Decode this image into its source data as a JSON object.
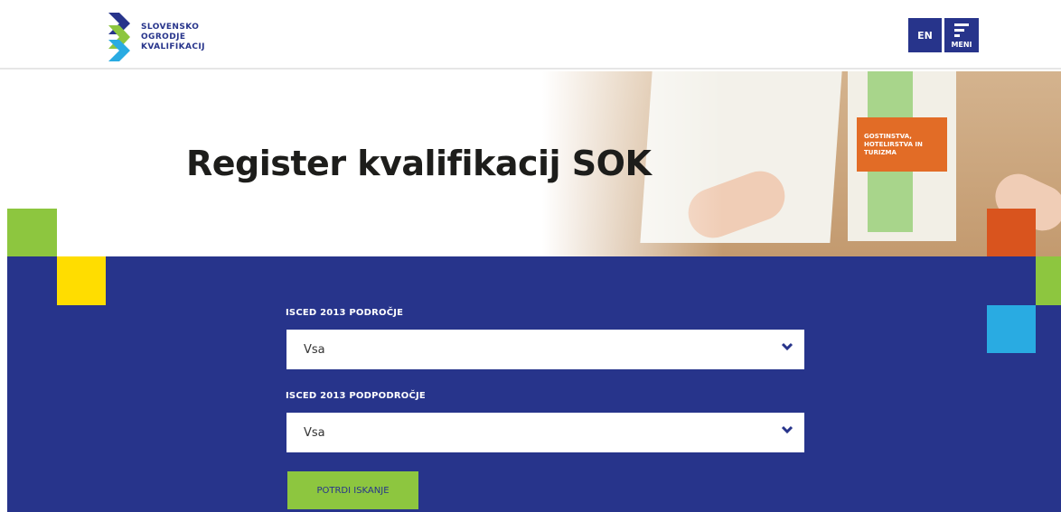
{
  "header": {
    "logo": {
      "line1": "SLOVENSKO",
      "line2": "OGRODJE",
      "line3": "KVALIFIKACIJ",
      "icon": "sok-chevrons-logo"
    },
    "lang_button": "EN",
    "menu_button": "MENI"
  },
  "hero": {
    "title": "Register kvalifikacij SOK",
    "booklet_text": "GOSTINSTVA, HOTELIRSTVA IN TURIZMA"
  },
  "search": {
    "field1_label": "ISCED 2013 PODROČJE",
    "field1_value": "Vsa",
    "field2_label": "ISCED 2013 PODPODROČJE",
    "field2_value": "Vsa",
    "submit_label": "POTRDI ISKANJE"
  },
  "colors": {
    "brand_blue": "#27348b",
    "green": "#8dc63f",
    "yellow": "#ffdd00",
    "orange": "#d9541e",
    "light_blue": "#29abe2"
  }
}
